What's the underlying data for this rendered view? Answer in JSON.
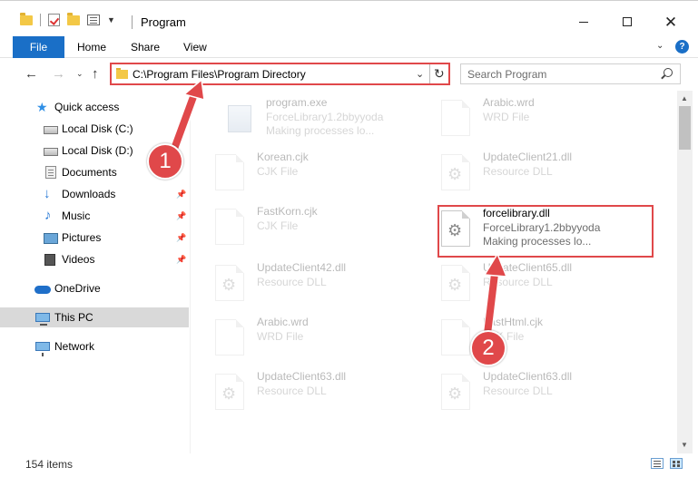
{
  "window": {
    "title": "Program",
    "minimize_glyph": "",
    "maximize_glyph": "",
    "close_glyph": "✕"
  },
  "ribbon": {
    "file": "File",
    "home": "Home",
    "share": "Share",
    "view": "View",
    "help": "?"
  },
  "address": {
    "path": "C:\\Program Files\\Program Directory",
    "dropdown": "⌄",
    "refresh": "↻"
  },
  "search": {
    "placeholder": "Search Program"
  },
  "nav": {
    "items": [
      {
        "label": "Quick access",
        "icon": "star-icon"
      },
      {
        "label": "Local Disk (C:)",
        "icon": "disk-icon",
        "pinned": true
      },
      {
        "label": "Local Disk (D:)",
        "icon": "disk-icon",
        "pinned": true
      },
      {
        "label": "Documents",
        "icon": "documents-icon",
        "pinned": true
      },
      {
        "label": "Downloads",
        "icon": "downloads-icon",
        "pinned": true
      },
      {
        "label": "Music",
        "icon": "music-icon",
        "pinned": true
      },
      {
        "label": "Pictures",
        "icon": "pictures-icon",
        "pinned": true
      },
      {
        "label": "Videos",
        "icon": "videos-icon",
        "pinned": true
      },
      {
        "label": "OneDrive",
        "icon": "onedrive-icon"
      },
      {
        "label": "This PC",
        "icon": "this-pc-icon",
        "selected": true
      },
      {
        "label": "Network",
        "icon": "network-icon"
      }
    ]
  },
  "files": [
    {
      "name": "program.exe",
      "line1": "ForceLibrary1.2bbyyoda",
      "line2": "Making processes lo...",
      "icon": "exe",
      "faded": true
    },
    {
      "name": "Arabic.wrd",
      "line1": "WRD File",
      "line2": "",
      "icon": "blank",
      "faded": true
    },
    {
      "name": "Korean.cjk",
      "line1": "CJK File",
      "line2": "",
      "icon": "blank",
      "faded": true
    },
    {
      "name": "UpdateClient21.dll",
      "line1": "Resource DLL",
      "line2": "",
      "icon": "gear",
      "faded": true
    },
    {
      "name": "FastKorn.cjk",
      "line1": "CJK File",
      "line2": "",
      "icon": "blank",
      "faded": true
    },
    {
      "name": "forcelibrary.dll",
      "line1": "ForceLibrary1.2bbyyoda",
      "line2": "Making processes lo...",
      "icon": "gear",
      "faded": false
    },
    {
      "name": "UpdateClient42.dll",
      "line1": "Resource DLL",
      "line2": "",
      "icon": "gear",
      "faded": true
    },
    {
      "name": "UpdateClient65.dll",
      "line1": "Resource DLL",
      "line2": "",
      "icon": "gear",
      "faded": true
    },
    {
      "name": "Arabic.wrd",
      "line1": "WRD File",
      "line2": "",
      "icon": "blank",
      "faded": true
    },
    {
      "name": "FastHtml.cjk",
      "line1": "CJK File",
      "line2": "",
      "icon": "blank",
      "faded": true
    },
    {
      "name": "UpdateClient63.dll",
      "line1": "Resource DLL",
      "line2": "",
      "icon": "gear",
      "faded": true
    },
    {
      "name": "UpdateClient63.dll",
      "line1": "Resource DLL",
      "line2": "",
      "icon": "gear",
      "faded": true
    }
  ],
  "status": {
    "count": "154 items"
  },
  "annotations": {
    "step1": "1",
    "step2": "2",
    "color": "#e0484a"
  },
  "colors": {
    "accent": "#1a6fc7",
    "highlight": "#e0484a",
    "selected_nav": "#d9d9d9"
  }
}
